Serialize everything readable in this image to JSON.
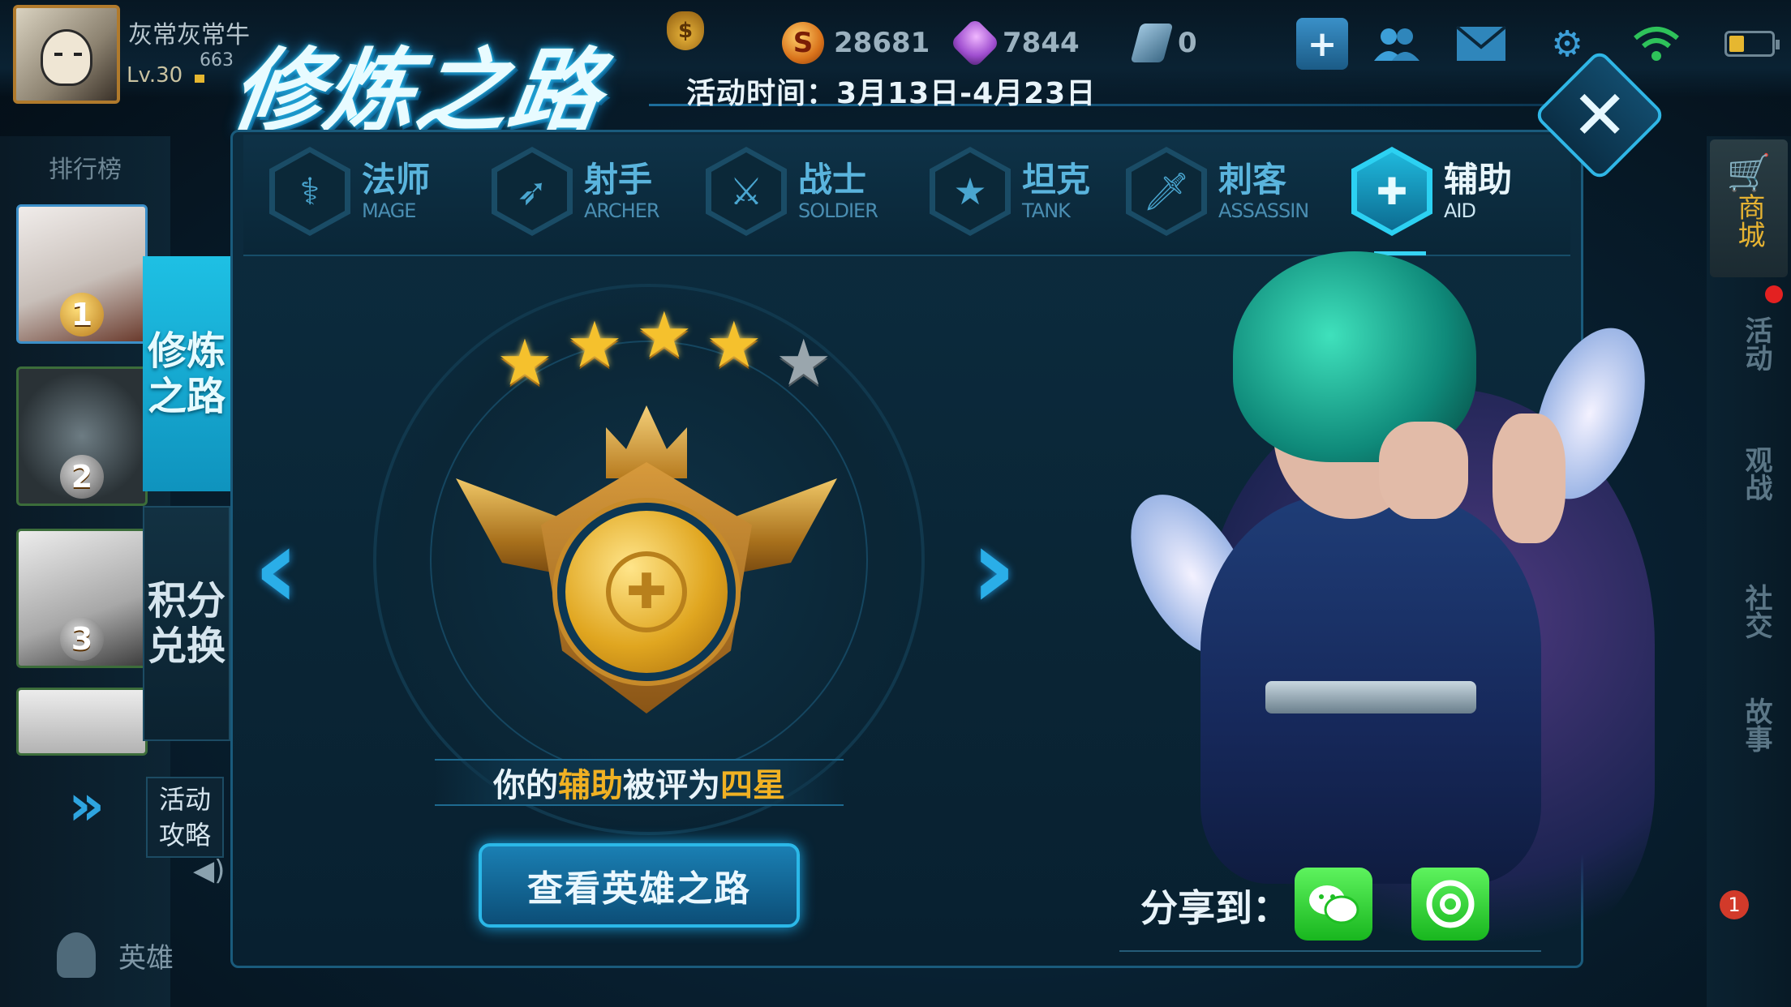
{
  "player": {
    "name": "灰常灰常牛",
    "level": "Lv.30",
    "exp": "663"
  },
  "currencies": {
    "gold": "28681",
    "gem": "7844",
    "voucher": "0",
    "gold_symbol": "S",
    "bag_symbol": "$"
  },
  "top_icons": [
    "plus-icon",
    "friends-icon",
    "mail-icon",
    "gear-icon",
    "wifi-icon",
    "battery-icon"
  ],
  "title": "修炼之路",
  "event_time": "活动时间：3月13日-4月23日",
  "leaderboard": {
    "title": "排行榜",
    "ranks": [
      "1",
      "2",
      "3"
    ]
  },
  "side_tabs": {
    "path": "修炼之路",
    "points": "积分兑换",
    "guide": "活动攻略"
  },
  "bottom_nav": {
    "hero": "英雄"
  },
  "classes": [
    {
      "cn": "法师",
      "en": "MAGE"
    },
    {
      "cn": "射手",
      "en": "ARCHER"
    },
    {
      "cn": "战士",
      "en": "SOLDIER"
    },
    {
      "cn": "坦克",
      "en": "TANK"
    },
    {
      "cn": "刺客",
      "en": "ASSASSIN"
    },
    {
      "cn": "辅助",
      "en": "AID"
    }
  ],
  "selected_class": "辅助",
  "rating": {
    "stars_filled": 4,
    "stars_total": 5,
    "prefix": "你的",
    "class_name": "辅助",
    "middle": "被评为",
    "grade": "四星",
    "suffix": ""
  },
  "view_button": "查看英雄之路",
  "share": {
    "label": "分享到："
  },
  "right_sidebar": {
    "mall": "商城",
    "activity": "活动",
    "watch": "观战",
    "social": "社交",
    "story": "故事",
    "badge": "1"
  },
  "colors": {
    "accent": "#2cd1f2",
    "gold": "#f0b123",
    "share_green": "#18b61e"
  }
}
